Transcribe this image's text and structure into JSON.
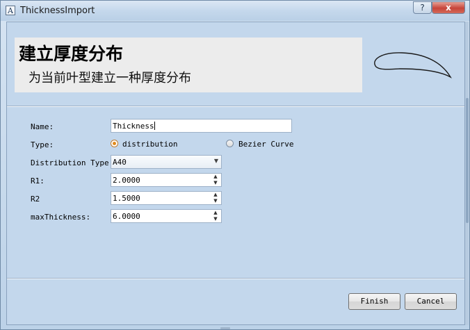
{
  "window": {
    "title": "ThicknessImport",
    "app_icon": "A",
    "help_label": "?",
    "close_label": "x"
  },
  "header": {
    "title": "建立厚度分布",
    "subtitle": "为当前叶型建立一种厚度分布",
    "icon": "airfoil-icon"
  },
  "form": {
    "name_label": "Name:",
    "name_value": "Thickness",
    "type_label": "Type:",
    "type_options": [
      "distribution",
      "Bezier Curve"
    ],
    "type_selected": "distribution",
    "dist_type_label": "Distribution Type:",
    "dist_type_value": "A40",
    "r1_label": "R1:",
    "r1_value": "2.0000",
    "r2_label": "R2",
    "r2_value": "1.5000",
    "max_thickness_label": "maxThickness:",
    "max_thickness_value": "6.0000"
  },
  "buttons": {
    "finish": "Finish",
    "cancel": "Cancel"
  },
  "colors": {
    "background": "#c3d7ec",
    "radio_accent": "#e08a1c",
    "close_button": "#c7443a"
  }
}
